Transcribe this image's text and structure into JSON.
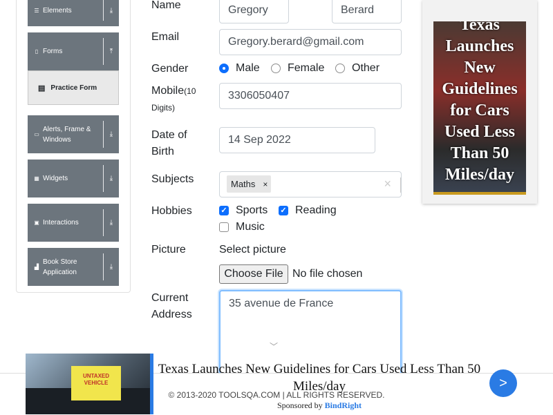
{
  "sidebar": {
    "groups": [
      {
        "label": "Elements",
        "icon": "list-icon"
      },
      {
        "label": "Forms",
        "icon": "document-icon"
      },
      {
        "label": "Alerts, Frame & Windows",
        "icon": "window-icon"
      },
      {
        "label": "Widgets",
        "icon": "grid-icon"
      },
      {
        "label": "Interactions",
        "icon": "cursor-icon"
      },
      {
        "label": "Book Store Application",
        "icon": "bar-chart-icon"
      }
    ],
    "active_item": "Practice Form"
  },
  "form": {
    "name_label": "Name",
    "first_name": "Gregory",
    "last_name": "Berard",
    "email_label": "Email",
    "email": "Gregory.berard@gmail.com",
    "gender_label": "Gender",
    "gender_options": [
      "Male",
      "Female",
      "Other"
    ],
    "gender_selected": "Male",
    "mobile_label": "Mobile",
    "mobile_hint": "(10 Digits)",
    "mobile": "3306050407",
    "dob_label_line1": "Date of",
    "dob_label_line2": "Birth",
    "dob": "14 Sep 2022",
    "subjects_label": "Subjects",
    "subjects": [
      "Maths"
    ],
    "hobbies_label": "Hobbies",
    "hobbies": [
      {
        "label": "Sports",
        "checked": true
      },
      {
        "label": "Reading",
        "checked": true
      },
      {
        "label": "Music",
        "checked": false
      }
    ],
    "picture_label": "Picture",
    "select_picture": "Select picture",
    "choose_file": "Choose File",
    "no_file": "No file chosen",
    "address_label_line1": "Current",
    "address_label_line2": "Address",
    "address": "35 avenue de France"
  },
  "side_ad": {
    "headline": "Texas Launches New Guidelines for Cars Used Less Than 50 Miles/day"
  },
  "bottom_ad": {
    "sign_line1": "UNTAXED",
    "sign_line2": "VEHICLE",
    "headline": "Texas Launches New Guidelines for Cars Used Less Than 50 Miles/day",
    "sponsored_by": "Sponsored by",
    "brand": "BindRight",
    "next": ">"
  },
  "footer": {
    "copyright": "© 2013-2020 TOOLSQA.COM | ALL RIGHTS RESERVED."
  },
  "colors": {
    "accent": "#0d6efd",
    "sidebar_group": "#6c757d",
    "ad_accent": "#2a7be4"
  }
}
